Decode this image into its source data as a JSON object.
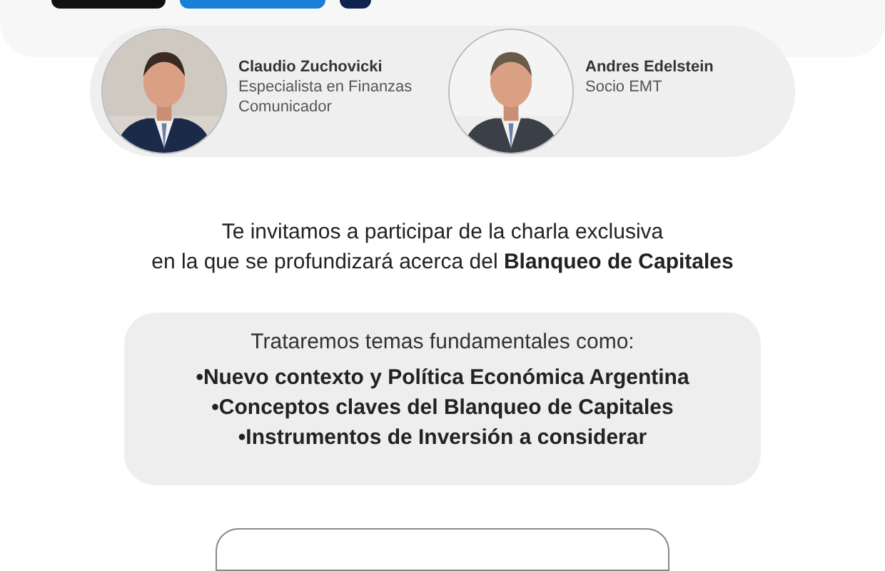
{
  "speakers": [
    {
      "name": "Claudio Zuchovicki",
      "role_lines": [
        "Especialista en Finanzas",
        "Comunicador"
      ]
    },
    {
      "name": "Andres Edelstein",
      "role_lines": [
        "Socio EMT"
      ]
    }
  ],
  "invitation": [
    "Te invitamos a participar de la charla exclusiva",
    "en la que se profundizará acerca del **Blanqueo de Capitales**"
  ],
  "topics": {
    "heading": "Trataremos temas fundamentales como:",
    "items": [
      "•Nuevo contexto y Política Económica Argentina",
      "•Conceptos claves del Blanqueo de Capitales",
      "•Instrumentos de Inversión a considerar"
    ]
  }
}
